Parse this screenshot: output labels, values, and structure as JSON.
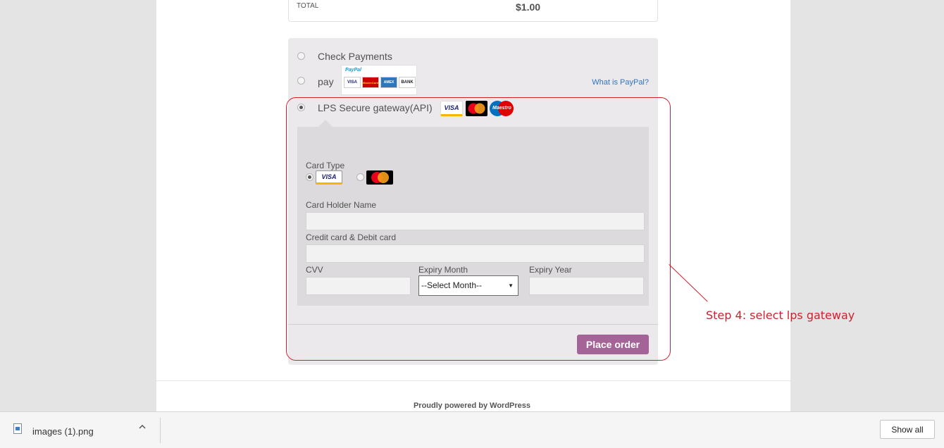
{
  "order": {
    "total_label": "TOTAL",
    "total_value": "$1.00"
  },
  "payment_methods": [
    {
      "label": "Check Payments",
      "selected": false
    },
    {
      "label": "pay",
      "selected": false
    },
    {
      "label": "LPS Secure gateway(API)",
      "selected": true
    }
  ],
  "paypal": {
    "brand": "PayPal",
    "logos": [
      "VISA",
      "MasterCard",
      "AMEX",
      "BANK"
    ],
    "link": "What is PayPal?"
  },
  "lps_logos": [
    "VISA",
    "MasterCard",
    "Maestro"
  ],
  "form": {
    "card_type_label": "Card Type",
    "card_types": [
      {
        "name": "VISA",
        "selected": true
      },
      {
        "name": "MasterCard",
        "selected": false
      }
    ],
    "holder_label": "Card Holder Name",
    "holder_value": "",
    "card_number_label": "Credit card & Debit card",
    "card_number_value": "",
    "cvv_label": "CVV",
    "cvv_value": "",
    "expiry_month_label": "Expiry Month",
    "expiry_month_value": "--Select Month--",
    "expiry_year_label": "Expiry Year",
    "expiry_year_value": ""
  },
  "place_order": "Place order",
  "annotation": "Step 4: select lps gateway",
  "footer": "Proudly powered by WordPress",
  "download_bar": {
    "file_name": "images (1).png",
    "show_all": "Show all"
  },
  "colors": {
    "accent": "#a46497",
    "annotation": "#d0202e",
    "link": "#2f74c0"
  }
}
